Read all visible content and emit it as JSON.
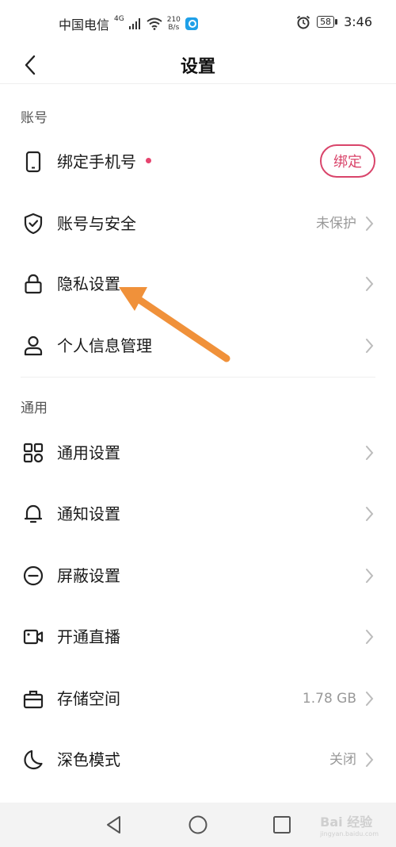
{
  "status_bar": {
    "carrier": "中国电信",
    "network": "4G",
    "speed_value": "210",
    "speed_unit": "B/s",
    "battery": "58",
    "time": "3:46"
  },
  "header": {
    "title": "设置"
  },
  "sections": {
    "account": {
      "label": "账号",
      "bind_phone": {
        "label": "绑定手机号",
        "button": "绑定",
        "icon": "phone-icon"
      },
      "account_security": {
        "label": "账号与安全",
        "value": "未保护",
        "icon": "shield-check-icon"
      },
      "privacy": {
        "label": "隐私设置",
        "icon": "lock-icon"
      },
      "personal_info": {
        "label": "个人信息管理",
        "icon": "person-icon"
      }
    },
    "general": {
      "label": "通用",
      "general_settings": {
        "label": "通用设置",
        "icon": "grid-icon"
      },
      "notification": {
        "label": "通知设置",
        "icon": "bell-icon"
      },
      "block": {
        "label": "屏蔽设置",
        "icon": "minus-circle-icon"
      },
      "live": {
        "label": "开通直播",
        "icon": "video-camera-icon"
      },
      "storage": {
        "label": "存储空间",
        "value": "1.78 GB",
        "icon": "briefcase-icon"
      },
      "dark_mode": {
        "label": "深色模式",
        "value": "关闭",
        "icon": "moon-icon"
      }
    }
  },
  "colors": {
    "accent": "#d9446a",
    "arrow": "#f0913a",
    "text_secondary": "#999999"
  },
  "watermark": {
    "text": "Bai 经验",
    "sub": "jingyan.baidu.com"
  }
}
